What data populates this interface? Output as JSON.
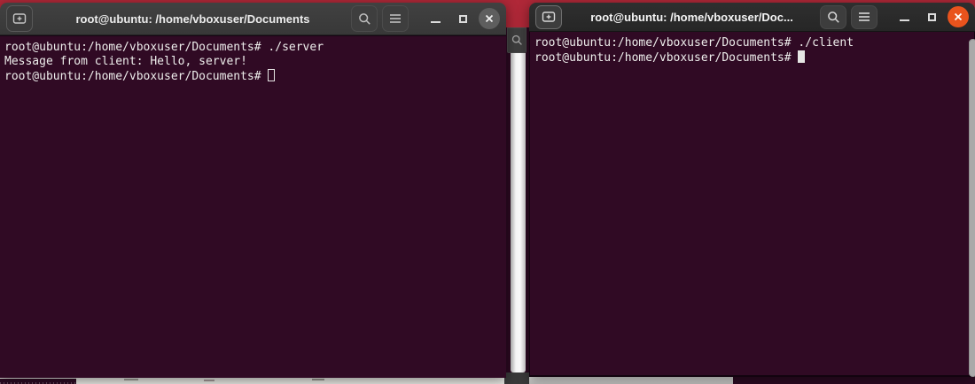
{
  "colors": {
    "desktop_background": "#a32331",
    "terminal_background": "#300a24",
    "terminal_foreground": "#eeeeec",
    "headerbar_focused": "#262626",
    "headerbar_unfocused": "#3a3a3a",
    "close_button_focused": "#e9531d",
    "close_button_unfocused": "#5e5e5e"
  },
  "icons": {
    "new_tab": "tab-with-plus",
    "search": "magnifier",
    "menu": "hamburger",
    "minimize": "dash",
    "maximize": "square-outline",
    "close": "x-in-circle"
  },
  "left_window": {
    "title": "root@ubuntu: /home/vboxuser/Documents",
    "focused": false,
    "cursor_style": "hollow",
    "terminal_lines": [
      "root@ubuntu:/home/vboxuser/Documents# ./server",
      "Message from client: Hello, server!",
      "root@ubuntu:/home/vboxuser/Documents# "
    ]
  },
  "right_window": {
    "title": "root@ubuntu: /home/vboxuser/Doc...",
    "focused": true,
    "cursor_style": "block",
    "terminal_lines": [
      "root@ubuntu:/home/vboxuser/Documents# ./client",
      "root@ubuntu:/home/vboxuser/Documents# "
    ]
  }
}
